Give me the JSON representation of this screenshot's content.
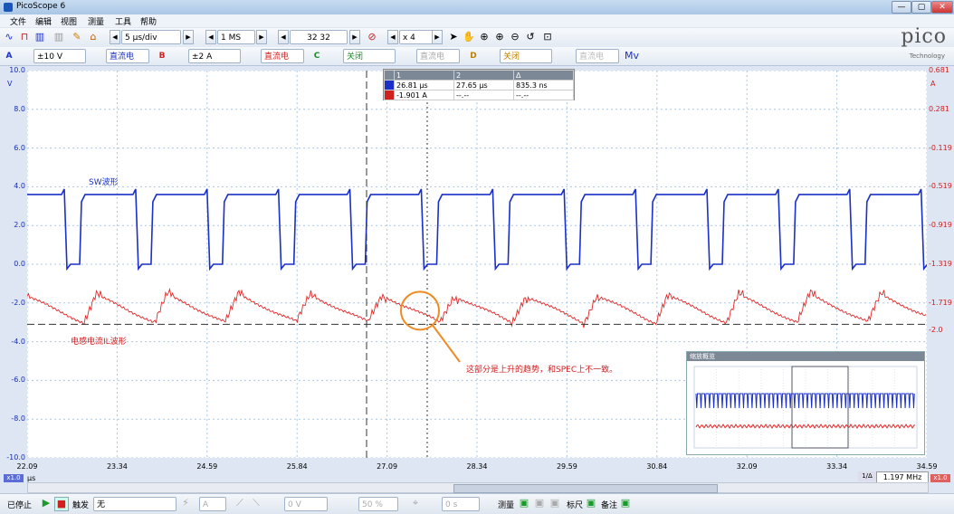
{
  "window": {
    "title": "PicoScope 6",
    "buttons": [
      "—",
      "▢",
      "✕"
    ]
  },
  "menu": [
    "文件",
    "编辑",
    "视图",
    "测量",
    "工具",
    "帮助"
  ],
  "toolbar1": {
    "timebase": "5 μs/div",
    "samples": "1 MS",
    "captures": "32 32",
    "zoom": "x 4"
  },
  "toolbar2": {
    "A": {
      "label": "A",
      "range": "±10 V",
      "coupling": "直流电"
    },
    "B": {
      "label": "B",
      "range": "±2 A",
      "coupling": "直流电"
    },
    "C": {
      "label": "C",
      "range": "关闭",
      "coupling": "直流电"
    },
    "D": {
      "label": "D",
      "range": "关闭",
      "coupling": "直流电"
    }
  },
  "logo": {
    "text": "pico",
    "sub": "Technology"
  },
  "axes": {
    "left_unit": "V",
    "right_unit": "A",
    "left_ticks": [
      "10.0",
      "8.0",
      "6.0",
      "4.0",
      "2.0",
      "0.0",
      "-2.0",
      "-4.0",
      "-6.0",
      "-8.0",
      "-10.0"
    ],
    "right_ticks": [
      "0.681",
      "0.281",
      "-0.119",
      "-0.519",
      "-0.919",
      "-1.319",
      "-1.719",
      "-2.0"
    ],
    "x_ticks": [
      "22.09",
      "23.34",
      "24.59",
      "25.84",
      "27.09",
      "28.34",
      "29.59",
      "30.84",
      "32.09",
      "33.34",
      "34.59"
    ],
    "x_unit": "μs",
    "left_scale_badge": "x1.0",
    "right_scale_badge": "x1.0"
  },
  "rulers": {
    "header": [
      "",
      "1",
      "2",
      "Δ"
    ],
    "row1": [
      "26.81 μs",
      "27.65 μs",
      "835.3 ns"
    ],
    "row2": [
      "-1.901 A",
      "--.--",
      "--.--"
    ]
  },
  "labels": {
    "sw": "SW波形",
    "il": "电感电流IL波形",
    "annotation": "这部分是上升的趋势，和SPEC上不一致。"
  },
  "zoom_panel": {
    "title": "缩放概览"
  },
  "status": {
    "frequency": "1.197 MHz",
    "ratio": "1/Δ"
  },
  "bottombar": {
    "state": "已停止",
    "trigger_label": "触发",
    "trigger_mode": "无",
    "trig_channel": "A",
    "trig_level": "0 V",
    "trig_percent": "50 %",
    "trig_time": "0 s",
    "measure": "测量",
    "ruler": "标尺",
    "notes": "备注"
  },
  "colors": {
    "channel_a": "#1a30c8",
    "channel_b": "#e02828",
    "orange": "#f08a24"
  }
}
